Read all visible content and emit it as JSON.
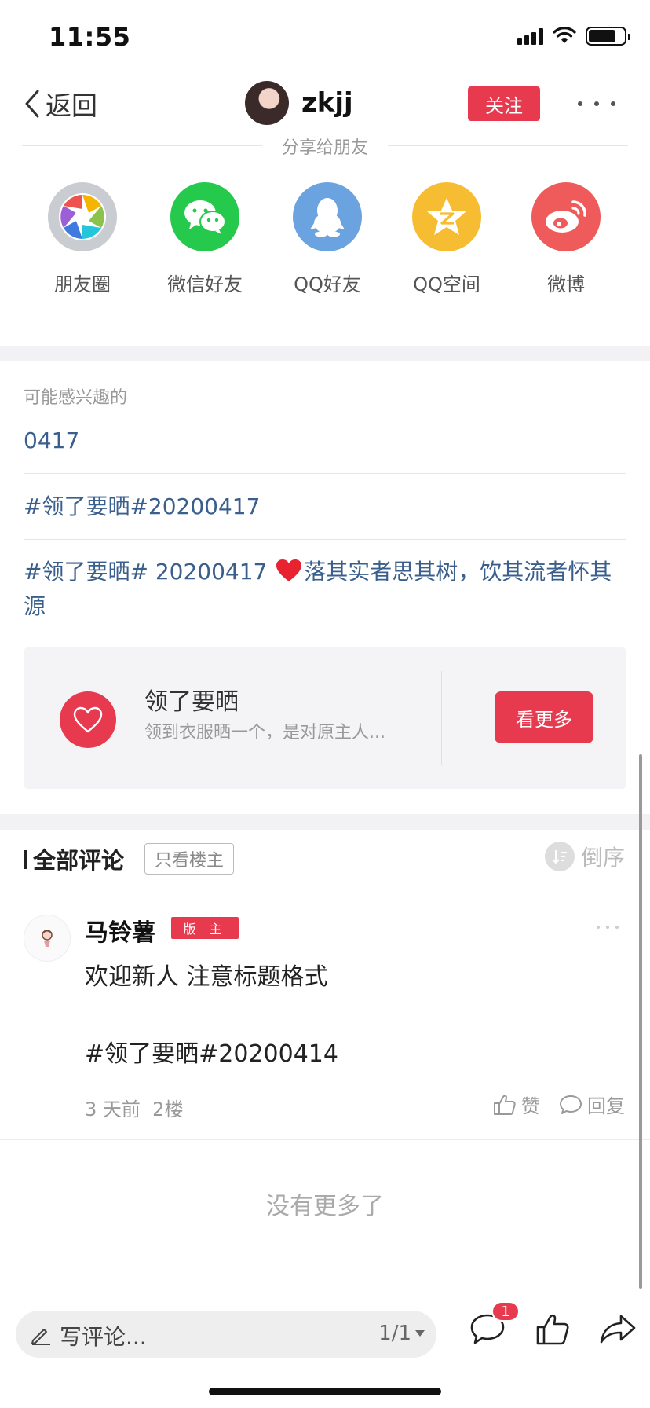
{
  "status_bar": {
    "time": "11:55"
  },
  "nav": {
    "back_label": "返回",
    "user_name": "zkjj",
    "follow_label": "关注"
  },
  "share": {
    "title": "分享给朋友",
    "items": [
      {
        "label": "朋友圈",
        "icon": "moments-icon",
        "color": "#c9ccd1"
      },
      {
        "label": "微信好友",
        "icon": "wechat-icon",
        "color": "#25c94c"
      },
      {
        "label": "QQ好友",
        "icon": "qq-icon",
        "color": "#6aa3e0"
      },
      {
        "label": "QQ空间",
        "icon": "qzone-icon",
        "color": "#f6bd33"
      },
      {
        "label": "微博",
        "icon": "weibo-icon",
        "color": "#ef5a5a"
      }
    ]
  },
  "interests": {
    "title": "可能感兴趣的",
    "items": [
      {
        "text": "0417"
      },
      {
        "text": "#领了要晒#20200417"
      },
      {
        "text_before": "#领了要晒# 20200417 ",
        "text_after": "落其实者思其树，饮其流者怀其源"
      }
    ]
  },
  "forum": {
    "title": "领了要晒",
    "description": "领到衣服晒一个，是对原主人...",
    "button": "看更多"
  },
  "comments": {
    "title": "全部评论",
    "op_filter": "只看楼主",
    "sort_label": "倒序",
    "items": [
      {
        "author": "马铃薯",
        "badge": "版 主",
        "text": "欢迎新人 注意标题格式",
        "tag": "#领了要晒#20200414",
        "time": "3 天前",
        "floor": "2楼",
        "like_label": "赞",
        "reply_label": "回复"
      }
    ]
  },
  "no_more": "没有更多了",
  "bottom_bar": {
    "input_placeholder": "写评论...",
    "page": "1/1",
    "comment_badge": "1"
  },
  "colors": {
    "accent": "#e83a4f",
    "link": "#3a5f8c"
  }
}
